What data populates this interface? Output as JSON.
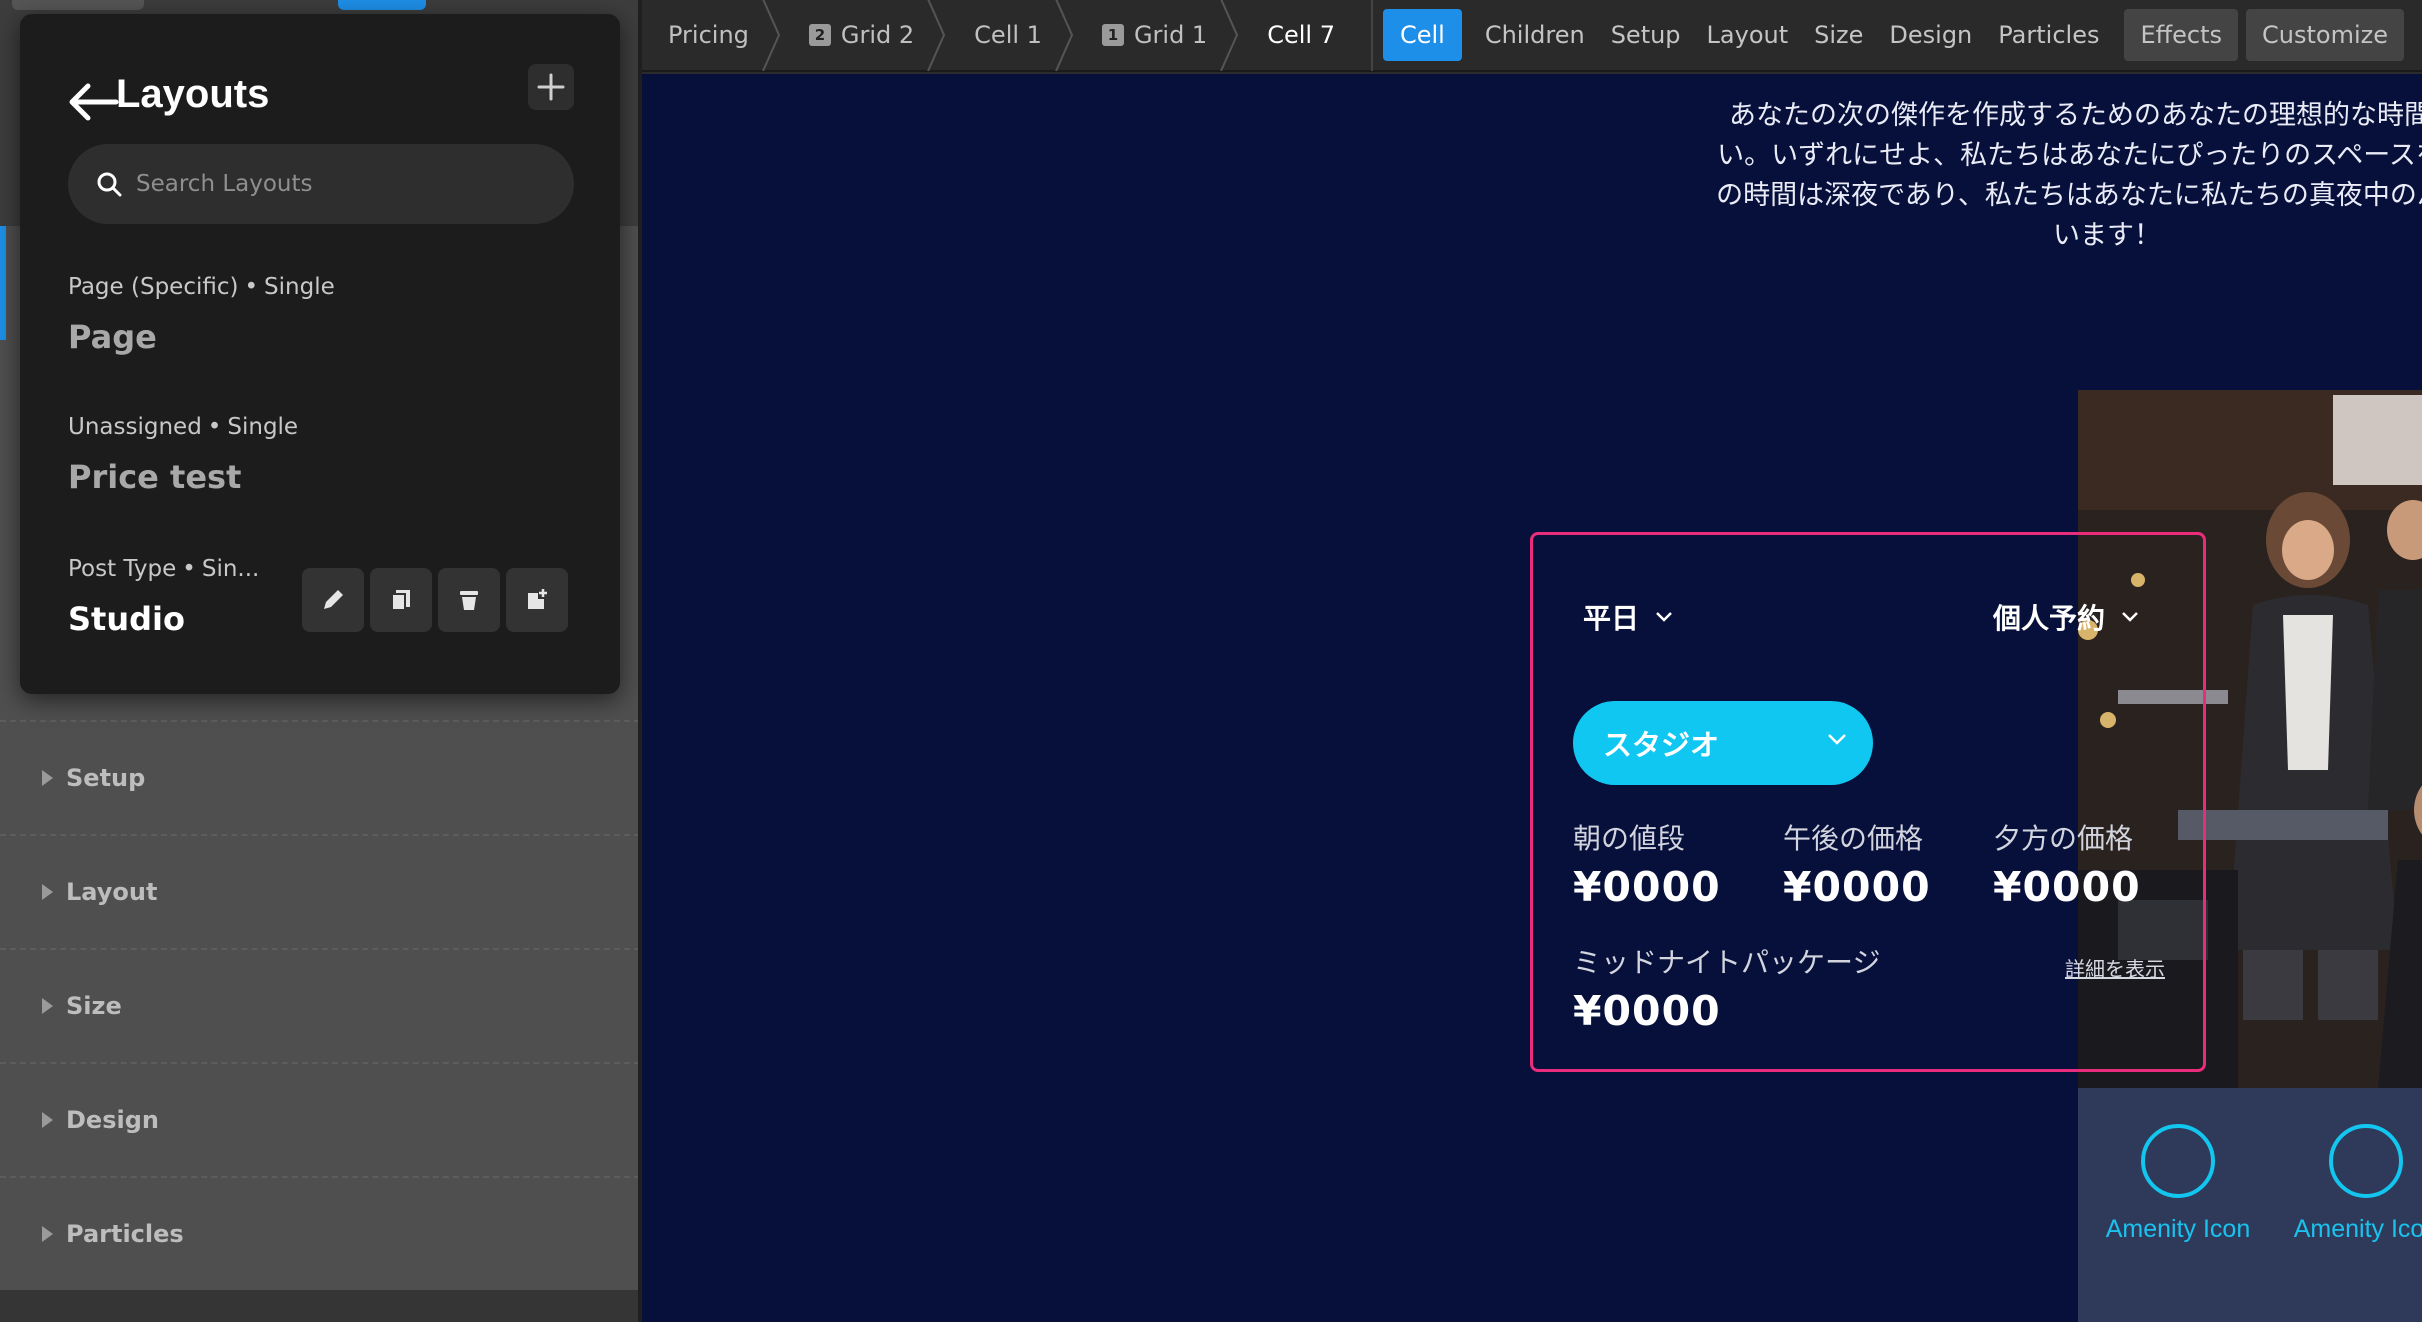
{
  "layouts_panel": {
    "title": "Layouts",
    "search_placeholder": "Search Layouts",
    "items": [
      {
        "type": "Page (Specific)",
        "mode": "Single",
        "name": "Page"
      },
      {
        "type": "Unassigned",
        "mode": "Single",
        "name": "Price test"
      },
      {
        "type": "Post Type",
        "mode": "Sin...",
        "name": "Studio"
      }
    ]
  },
  "sidebar": {
    "sections": [
      "Setup",
      "Layout",
      "Size",
      "Design",
      "Particles"
    ]
  },
  "topbar": {
    "breadcrumbs": [
      {
        "label": "Pricing",
        "badge": ""
      },
      {
        "label": "Grid 2",
        "badge": "2"
      },
      {
        "label": "Cell 1",
        "badge": ""
      },
      {
        "label": "Grid 1",
        "badge": "1"
      },
      {
        "label": "Cell 7",
        "badge": ""
      }
    ],
    "active_tab": "Cell",
    "tabs": [
      "Children",
      "Setup",
      "Layout",
      "Size",
      "Design",
      "Particles"
    ],
    "boxed_tabs": [
      "Effects",
      "Customize"
    ]
  },
  "canvas": {
    "intro_lines": [
      "あなたの次の傑作を作成するためのあなたの理想的な時間と価",
      "い。いずれにせよ、私たちはあなたにぴったりのスペースを持っ",
      "の時間は深夜であり、私たちはあなたに私たちの真夜中のパッケ",
      "います！"
    ],
    "price_card": {
      "day_select": "平日",
      "booking_select": "個人予約",
      "room_select": "スタジオ",
      "prices": [
        {
          "label": "朝の値段",
          "value": "¥0000"
        },
        {
          "label": "午後の価格",
          "value": "¥0000"
        },
        {
          "label": "夕方の価格",
          "value": "¥0000"
        },
        {
          "label": "ミッドナイトパッケージ",
          "value": "¥0000"
        }
      ],
      "details_link": "詳細を表示"
    },
    "amenities": [
      {
        "label": "Amenity Icon"
      },
      {
        "label": "Amenity Icon"
      }
    ]
  },
  "colors": {
    "accent_blue": "#1e8fe8",
    "canvas_bg": "#07103b",
    "card_border": "#ea2c7c",
    "studio_button": "#10c7f2",
    "amenity_cyan": "#19c3ee"
  }
}
